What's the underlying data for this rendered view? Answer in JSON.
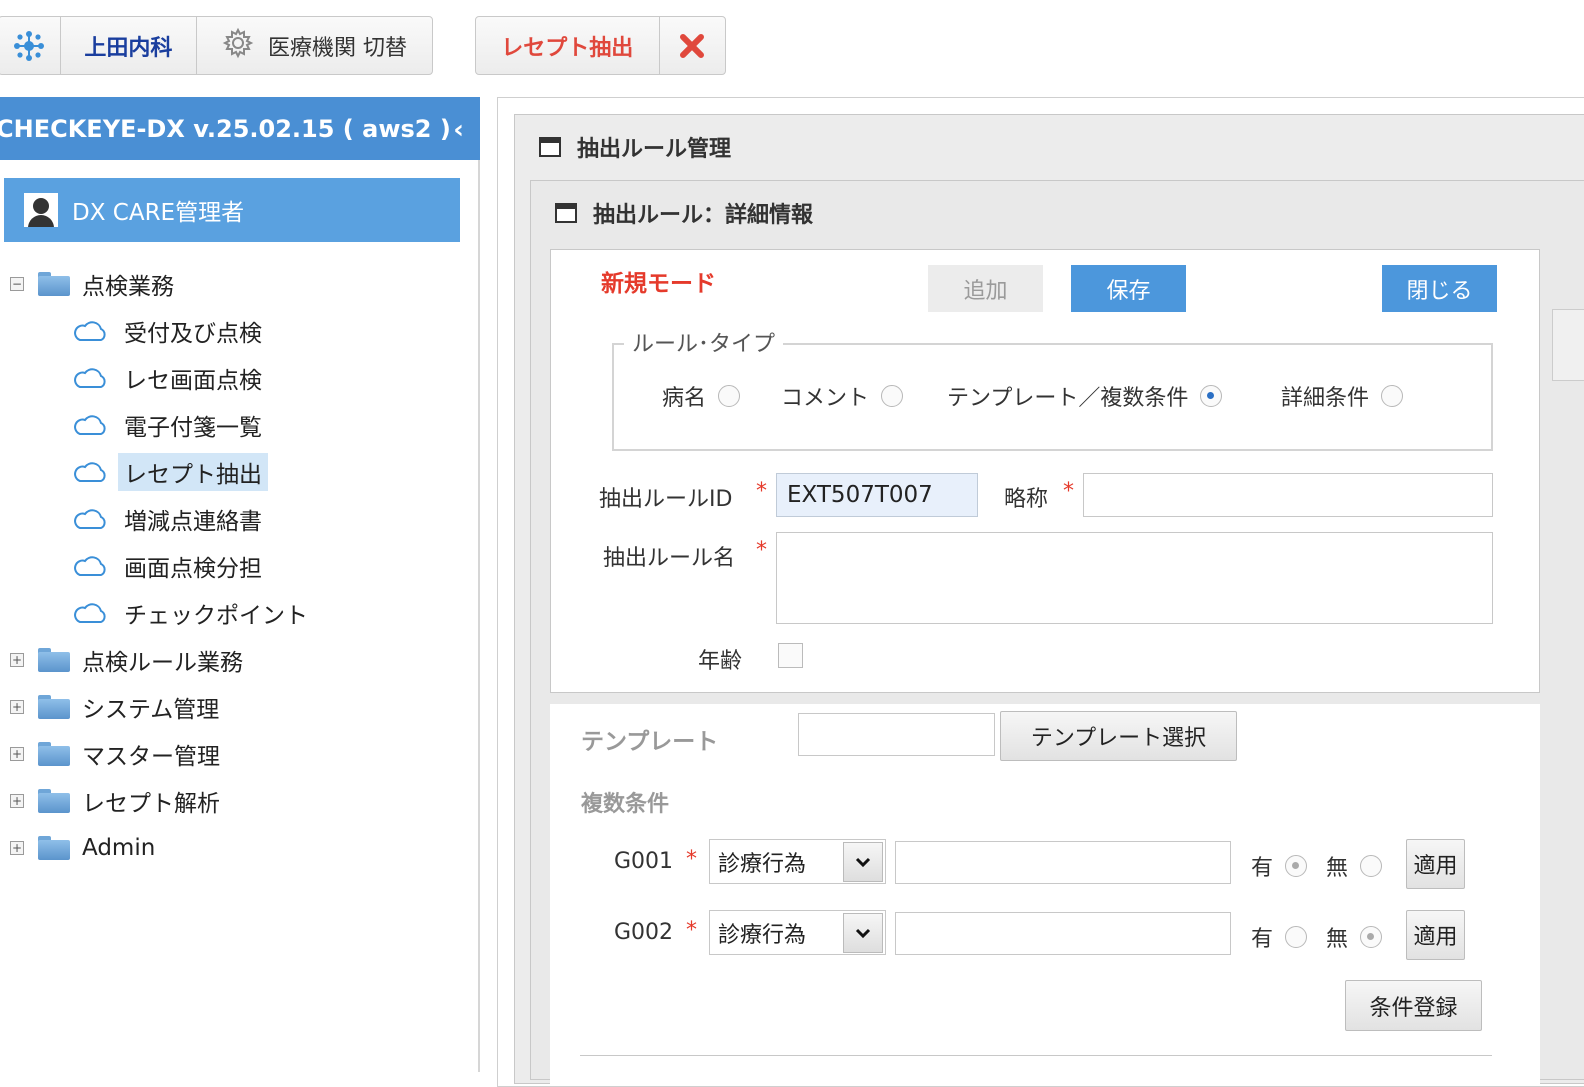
{
  "toolbar": {
    "clinic_name": "上田内科",
    "switch_label": "医療機関 切替",
    "tab_label": "レセプト抽出"
  },
  "left": {
    "header_title": "CHECKEYE-DX v.25.02.15 ( aws2 )",
    "user_name": "DX CARE管理者",
    "tree": {
      "group_open": "点検業務",
      "items": [
        "受付及び点検",
        "レセ画面点検",
        "電子付箋一覧",
        "レセプト抽出",
        "増減点連絡書",
        "画面点検分担",
        "チェックポイント"
      ],
      "groups_closed": [
        "点検ルール業務",
        "システム管理",
        "マスター管理",
        "レセプト解析",
        "Admin"
      ]
    }
  },
  "main": {
    "panel_title": "抽出ルール管理",
    "detail_title": "抽出ルール：詳細情報",
    "mode_label": "新規モード",
    "buttons": {
      "add": "追加",
      "save": "保存",
      "close": "閉じる"
    },
    "rule_type": {
      "legend": "ルール･タイプ",
      "options": [
        "病名",
        "コメント",
        "テンプレート／複数条件",
        "詳細条件"
      ],
      "selected": "テンプレート／複数条件"
    },
    "fields": {
      "rule_id_label": "抽出ルールID",
      "rule_id_value": "EXT507T007",
      "short_name_label": "略称",
      "short_name_value": "",
      "rule_name_label": "抽出ルール名",
      "rule_name_value": "",
      "age_label": "年齢",
      "required_mark": "*"
    },
    "template": {
      "label": "テンプレート",
      "value": "",
      "select_button": "テンプレート選択"
    },
    "conditions": {
      "label": "複数条件",
      "rows": [
        {
          "id": "G001",
          "type": "診療行為",
          "value": "",
          "yes": "有",
          "no": "無",
          "selected": "有",
          "apply": "適用"
        },
        {
          "id": "G002",
          "type": "診療行為",
          "value": "",
          "yes": "有",
          "no": "無",
          "selected": "無",
          "apply": "適用"
        }
      ],
      "register_button": "条件登録"
    }
  }
}
